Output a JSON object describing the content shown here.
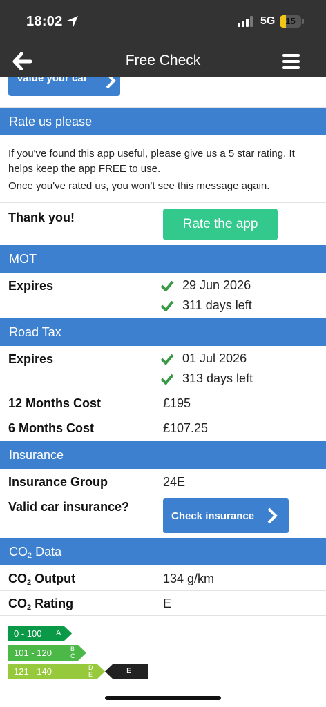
{
  "status_bar": {
    "time": "18:02",
    "network": "5G",
    "battery": "15",
    "battery_level": 0.15
  },
  "nav": {
    "title": "Free Check",
    "back_icon": "arrow-left-icon",
    "menu_icon": "hamburger-icon"
  },
  "value_button": {
    "label": "Value your car"
  },
  "rate_section": {
    "title": "Rate us please",
    "paragraph1": "If you've found this app useful, please give us a 5 star rating. It helps keep the app FREE to use.",
    "paragraph2": "Once you've rated us, you won't see this message again.",
    "thanks": "Thank you!",
    "rate_button": "Rate the app"
  },
  "mot": {
    "title": "MOT",
    "label": "Expires",
    "date": "29 Jun 2026",
    "days_left": "311 days left"
  },
  "road_tax": {
    "title": "Road Tax",
    "label": "Expires",
    "date": "01 Jul 2026",
    "days_left": "313 days left",
    "cost12_label": "12 Months Cost",
    "cost12": "£195",
    "cost6_label": "6 Months Cost",
    "cost6": "£107.25"
  },
  "insurance": {
    "title": "Insurance",
    "group_label": "Insurance Group",
    "group": "24E",
    "valid_label": "Valid car insurance?",
    "check_button": "Check insurance"
  },
  "co2": {
    "title_prefix": "CO",
    "title_sub": "2",
    "title_suffix": " Data",
    "output_label_prefix": "CO",
    "output_label_sub": "2",
    "output_label_suffix": " Output",
    "output": "134 g/km",
    "rating_label_prefix": "CO",
    "rating_label_sub": "2",
    "rating_label_suffix": " Rating",
    "rating": "E",
    "bands": [
      {
        "range": "0 - 100",
        "letter": "A",
        "color": "#0a9a47"
      },
      {
        "range": "101 - 120",
        "letter_top": "B",
        "letter_bottom": "C",
        "color": "#4cb848"
      },
      {
        "range": "121 - 140",
        "letter_top": "D",
        "letter_bottom": "E",
        "color": "#97c93c"
      }
    ],
    "marker": {
      "letter": "E",
      "color": "#222222"
    }
  },
  "accent_color": "#3d80d0",
  "rate_button_color": "#33c98d",
  "check_icon_color": "#3a9a48"
}
